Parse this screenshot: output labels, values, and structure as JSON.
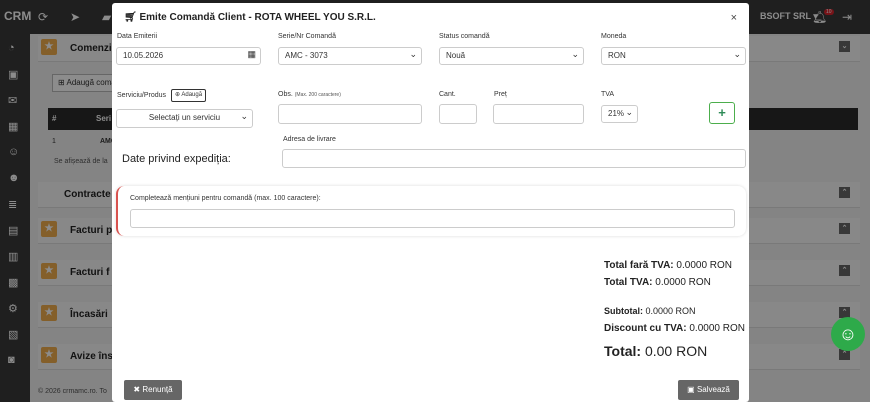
{
  "app": {
    "brand": "CRM",
    "company_menu": "BSOFT SRL",
    "notification_count": "10",
    "footer": "© 2026 crmamc.ro. To"
  },
  "background": {
    "panels": [
      {
        "label": "Comenzi",
        "top": 0
      },
      {
        "label": "Contracte"
      },
      {
        "label": "Facturi p"
      },
      {
        "label": "Facturi f"
      },
      {
        "label": "Încasări"
      },
      {
        "label": "Avize îns"
      }
    ],
    "add_button": "Adaugă coma",
    "table_headers": [
      "#",
      "Seri"
    ],
    "table_row": [
      "1",
      "AMC"
    ],
    "table_footer": "Se afișează de la"
  },
  "modal": {
    "title": "Emite Comandă Client - ROTA WHEEL YOU S.R.L.",
    "close": "×",
    "fields": {
      "data_emiterii_label": "Data Emiterii",
      "data_emiterii_value": "10.05.2026",
      "serie_label": "Serie/Nr Comandă",
      "serie_value": "AMC - 3073",
      "status_label": "Status comandă",
      "status_value": "Nouă",
      "moneda_label": "Moneda",
      "moneda_value": "RON",
      "serviciu_label": "Serviciu/Produs",
      "adauga_label": "Adaugă",
      "serviciu_value": "Selectați un serviciu",
      "obs_label": "Obs.",
      "obs_hint": "(Max. 200 caractere)",
      "cant_label": "Cant.",
      "pret_label": "Preț",
      "tva_label": "TVA",
      "tva_value": "21%",
      "plus": "+",
      "adresa_label": "Adresa de livrare",
      "expeditie_title": "Date privind expediția:",
      "mentiuni_label": "Completează mențiuni pentru comandă (max. 100 caractere):"
    },
    "totals": {
      "fara_tva_label": "Total fară TVA:",
      "fara_tva_value": "0.0000 RON",
      "tva_label": "Total TVA:",
      "tva_value": "0.0000 RON",
      "subtotal_label": "Subtotal:",
      "subtotal_value": "0.0000 RON",
      "discount_label": "Discount cu TVA:",
      "discount_value": "0.0000 RON",
      "total_label": "Total:",
      "total_value": "0.00 RON"
    },
    "buttons": {
      "renunta": "Renunță",
      "salveaza": "Salvează"
    }
  }
}
